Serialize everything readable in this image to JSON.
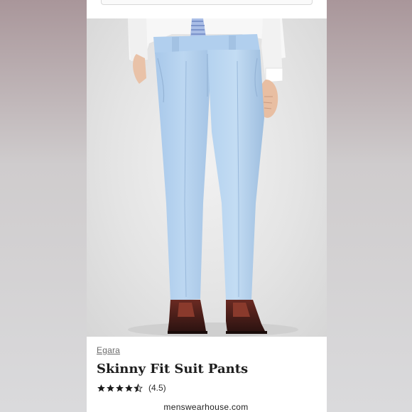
{
  "product": {
    "brand": "Egara",
    "name": "Skinny Fit Suit Pants",
    "rating": 4.5,
    "rating_text": "(4.5)",
    "color": "#b7d3ee"
  },
  "footer": {
    "site": "menswearhouse.com"
  }
}
